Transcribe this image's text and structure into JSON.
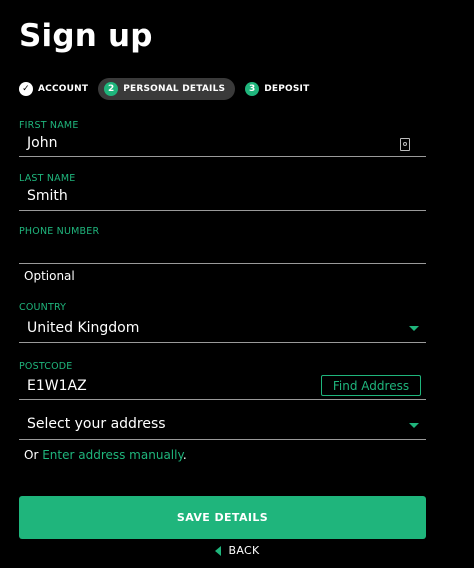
{
  "page": {
    "title": "Sign up"
  },
  "steps": [
    {
      "number": "✓",
      "label": "ACCOUNT"
    },
    {
      "number": "2",
      "label": "PERSONAL DETAILS"
    },
    {
      "number": "3",
      "label": "DEPOSIT"
    }
  ],
  "form": {
    "first_name": {
      "label": "FIRST NAME",
      "value": "John"
    },
    "last_name": {
      "label": "LAST NAME",
      "value": "Smith"
    },
    "phone": {
      "label": "PHONE NUMBER",
      "value": "",
      "hint": "Optional"
    },
    "country": {
      "label": "COUNTRY",
      "value": "United Kingdom"
    },
    "postcode": {
      "label": "POSTCODE",
      "value": "E1W1AZ",
      "find_button": "Find Address"
    },
    "address_select": {
      "value": "Select your address"
    },
    "manual": {
      "prefix": "Or ",
      "link": "Enter address manually",
      "suffix": "."
    }
  },
  "actions": {
    "save": "SAVE DETAILS",
    "back": "BACK"
  },
  "colors": {
    "accent": "#1fb57c",
    "background": "#000000",
    "step_active_bg": "#3a3a3a"
  }
}
